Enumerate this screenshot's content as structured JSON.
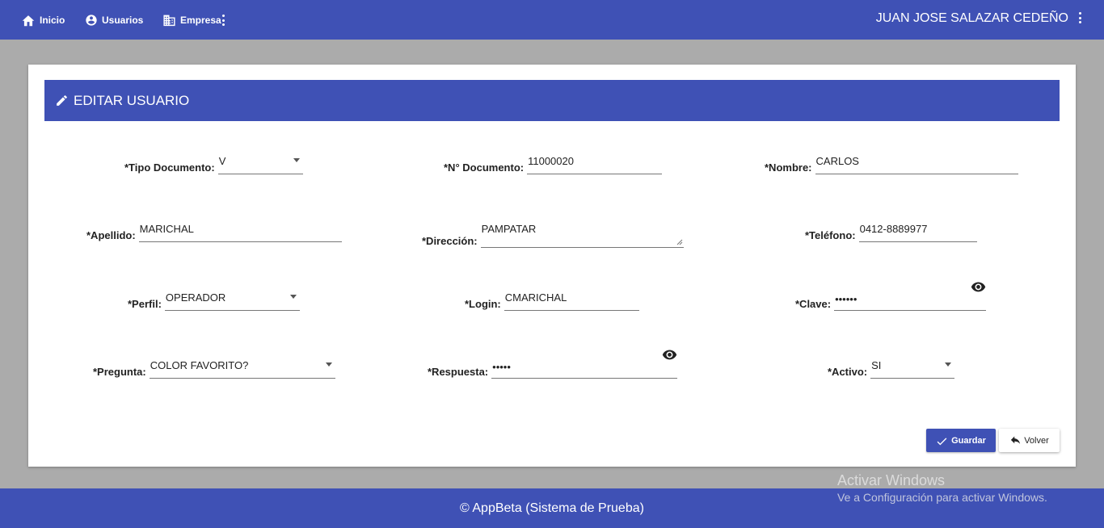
{
  "topbar": {
    "nav": [
      {
        "label": "Inicio",
        "icon": "home-icon"
      },
      {
        "label": "Usuarios",
        "icon": "account-circle-icon"
      },
      {
        "label": "Empresa",
        "icon": "business-icon"
      }
    ],
    "user_name": "JUAN JOSE SALAZAR CEDEÑO"
  },
  "card": {
    "title": "EDITAR USUARIO",
    "title_icon": "pencil-icon"
  },
  "form": {
    "tipo_documento": {
      "label": "*Tipo Documento:",
      "value": "V"
    },
    "n_documento": {
      "label": "*N° Documento:",
      "value": "11000020"
    },
    "nombre": {
      "label": "*Nombre:",
      "value": "CARLOS"
    },
    "apellido": {
      "label": "*Apellido:",
      "value": "MARICHAL"
    },
    "direccion": {
      "label": "*Dirección:",
      "value": "PAMPATAR"
    },
    "telefono": {
      "label": "*Teléfono:",
      "value": "0412-8889977"
    },
    "perfil": {
      "label": "*Perfil:",
      "value": "OPERADOR"
    },
    "login": {
      "label": "*Login:",
      "value": "CMARICHAL"
    },
    "clave": {
      "label": "*Clave:",
      "value": "••••••"
    },
    "pregunta": {
      "label": "*Pregunta:",
      "value": "COLOR FAVORITO?"
    },
    "respuesta": {
      "label": "*Respuesta:",
      "value": "•••••"
    },
    "activo": {
      "label": "*Activo:",
      "value": "SI"
    }
  },
  "buttons": {
    "save": "Guardar",
    "back": "Volver"
  },
  "footer": {
    "text": "© AppBeta (Sistema de Prueba)"
  },
  "watermark": {
    "line1": "Activar Windows",
    "line2": "Ve a Configuración para activar Windows."
  },
  "colors": {
    "primary": "#3f51b5",
    "background": "#ababab"
  }
}
